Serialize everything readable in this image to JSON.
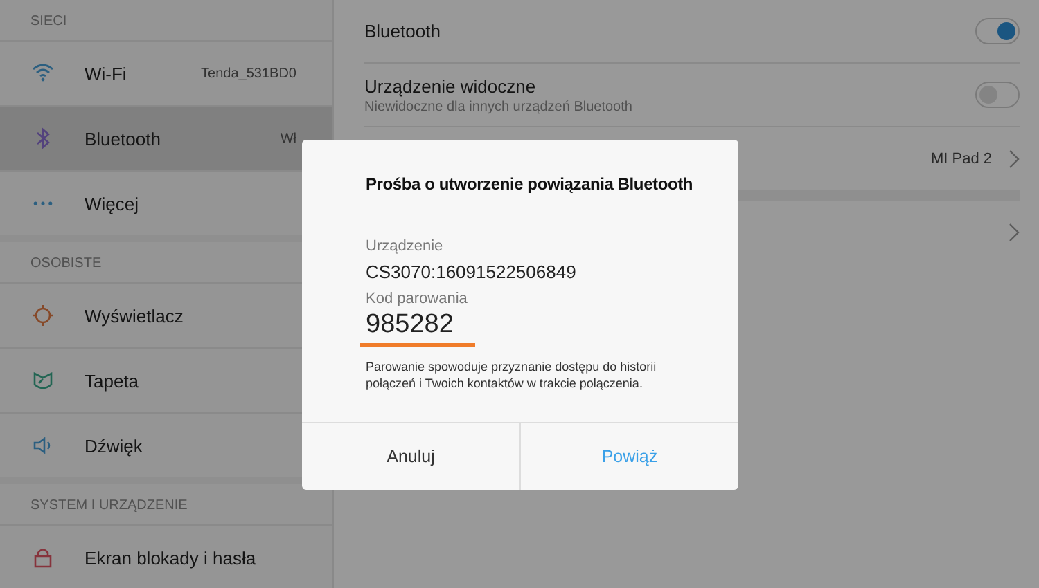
{
  "sidebar": {
    "sections": [
      {
        "header": "SIECI",
        "items": [
          {
            "kind": "wifi",
            "label": "Wi-Fi",
            "value": "Tenda_531BD0",
            "selected": false
          },
          {
            "kind": "bluetooth",
            "label": "Bluetooth",
            "value": "Wł",
            "selected": true
          },
          {
            "kind": "dots",
            "label": "Więcej",
            "selected": false
          }
        ]
      },
      {
        "header": "OSOBISTE",
        "items": [
          {
            "kind": "display",
            "label": "Wyświetlacz",
            "selected": false
          },
          {
            "kind": "wallpaper",
            "label": "Tapeta",
            "selected": false
          },
          {
            "kind": "sound",
            "label": "Dźwięk",
            "selected": false
          }
        ]
      },
      {
        "header": "SYSTEM I URZĄDZENIE",
        "items": [
          {
            "kind": "lock",
            "label": "Ekran blokady i hasła",
            "selected": false
          }
        ]
      }
    ]
  },
  "settings": {
    "groups": [
      {
        "rows": [
          {
            "kind": "toggle",
            "title": "Bluetooth",
            "on": true
          },
          {
            "kind": "toggle",
            "title": "Urządzenie widoczne",
            "subtitle": "Niewidoczne dla innych urządzeń Bluetooth",
            "on": false
          },
          {
            "kind": "link",
            "value": "MI Pad 2"
          }
        ]
      },
      {
        "rows": [
          {
            "kind": "link"
          }
        ]
      }
    ]
  },
  "dialog": {
    "title": "Prośba o utworzenie powiązania Bluetooth",
    "device_label": "Urządzenie",
    "device": "CS3070:16091522506849",
    "code_label": "Kod parowania",
    "code": "985282",
    "note": "Parowanie spowoduje przyznanie dostępu do historii połączeń i Twoich kontaktów w trakcie połączenia.",
    "buttons": [
      {
        "label": "Anuluj",
        "kind": "cancel"
      },
      {
        "label": "Powiąż",
        "kind": "confirm"
      }
    ]
  }
}
